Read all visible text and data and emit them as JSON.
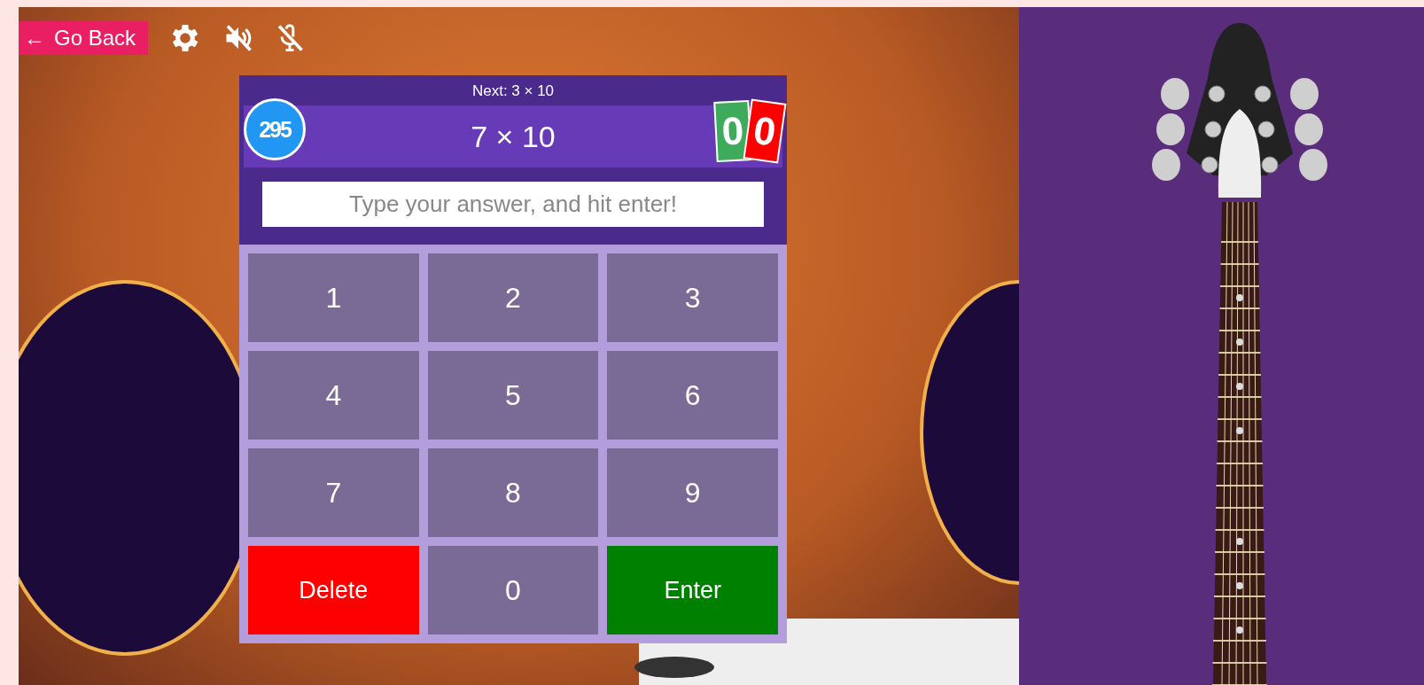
{
  "toolbar": {
    "back_arrow": "←",
    "back_label": "Go Back"
  },
  "game": {
    "next": "Next: 3 × 10",
    "question": "7 × 10",
    "score": "295",
    "correct": "0",
    "wrong": "0",
    "answer_placeholder": "Type your answer, and hit enter!",
    "keys": [
      {
        "label": "1",
        "kind": "digit"
      },
      {
        "label": "2",
        "kind": "digit"
      },
      {
        "label": "3",
        "kind": "digit"
      },
      {
        "label": "4",
        "kind": "digit"
      },
      {
        "label": "5",
        "kind": "digit"
      },
      {
        "label": "6",
        "kind": "digit"
      },
      {
        "label": "7",
        "kind": "digit"
      },
      {
        "label": "8",
        "kind": "digit"
      },
      {
        "label": "9",
        "kind": "digit"
      },
      {
        "label": "Delete",
        "kind": "delete"
      },
      {
        "label": "0",
        "kind": "digit"
      },
      {
        "label": "Enter",
        "kind": "enter"
      }
    ]
  }
}
